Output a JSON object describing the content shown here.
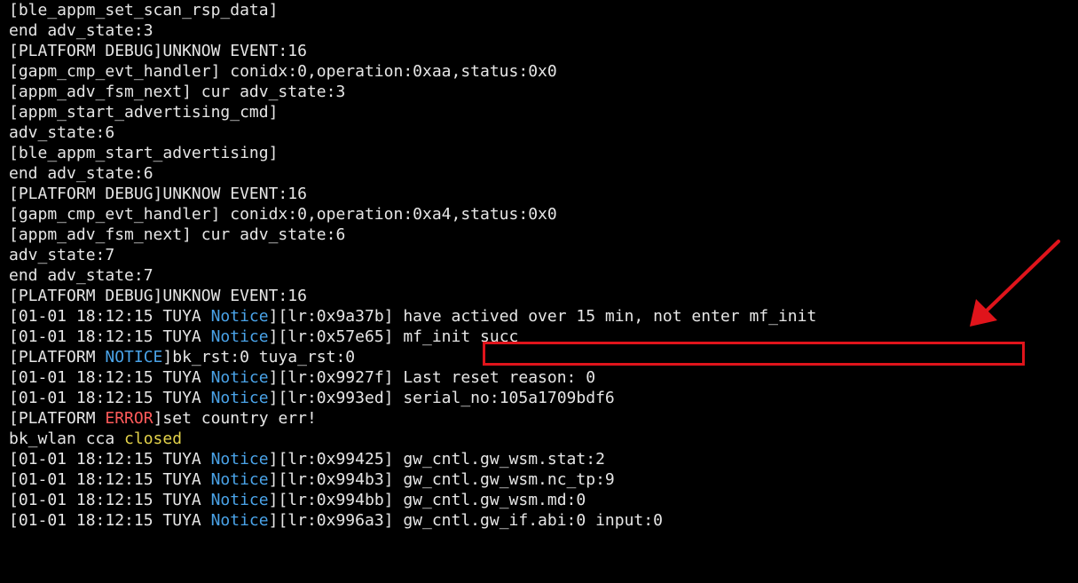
{
  "colors": {
    "background": "#000000",
    "text": "#e6e6e6",
    "notice_blue": "#4aa3e8",
    "error_red": "#ff5a5a",
    "closed_yellow": "#e3d24a",
    "annotation_red": "#e0141b"
  },
  "annotation": {
    "box_label": "highlighted log message",
    "arrow_icon": "red-arrow-icon"
  },
  "terminal": {
    "lines": [
      [
        {
          "t": "[ble_appm_set_scan_rsp_data]",
          "c": "default"
        }
      ],
      [
        {
          "t": "end adv_state:3",
          "c": "default"
        }
      ],
      [
        {
          "t": "[PLATFORM DEBUG]UNKNOW EVENT:16",
          "c": "default"
        }
      ],
      [
        {
          "t": "[gapm_cmp_evt_handler] conidx:0,operation:0xaa,status:0x0",
          "c": "default"
        }
      ],
      [
        {
          "t": "[appm_adv_fsm_next] cur adv_state:3",
          "c": "default"
        }
      ],
      [
        {
          "t": "[appm_start_advertising_cmd]",
          "c": "default"
        }
      ],
      [
        {
          "t": "adv_state:6",
          "c": "default"
        }
      ],
      [
        {
          "t": "[ble_appm_start_advertising]",
          "c": "default"
        }
      ],
      [
        {
          "t": "end adv_state:6",
          "c": "default"
        }
      ],
      [
        {
          "t": "[PLATFORM DEBUG]UNKNOW EVENT:16",
          "c": "default"
        }
      ],
      [
        {
          "t": "[gapm_cmp_evt_handler] conidx:0,operation:0xa4,status:0x0",
          "c": "default"
        }
      ],
      [
        {
          "t": "[appm_adv_fsm_next] cur adv_state:6",
          "c": "default"
        }
      ],
      [
        {
          "t": "adv_state:7",
          "c": "default"
        }
      ],
      [
        {
          "t": "end adv_state:7",
          "c": "default"
        }
      ],
      [
        {
          "t": "[PLATFORM DEBUG]UNKNOW EVENT:16",
          "c": "default"
        }
      ],
      [
        {
          "t": "[01-01 18:12:15 TUYA ",
          "c": "default"
        },
        {
          "t": "Notice",
          "c": "blue"
        },
        {
          "t": "][lr:0x9a37b] have actived over 15 min, not enter mf_init",
          "c": "default"
        }
      ],
      [
        {
          "t": "[01-01 18:12:15 TUYA ",
          "c": "default"
        },
        {
          "t": "Notice",
          "c": "blue"
        },
        {
          "t": "][lr:0x57e65] mf_init succ",
          "c": "default"
        }
      ],
      [
        {
          "t": "[PLATFORM ",
          "c": "default"
        },
        {
          "t": "NOTICE",
          "c": "blue"
        },
        {
          "t": "]bk_rst:0 tuya_rst:0",
          "c": "default"
        }
      ],
      [
        {
          "t": "[01-01 18:12:15 TUYA ",
          "c": "default"
        },
        {
          "t": "Notice",
          "c": "blue"
        },
        {
          "t": "][lr:0x9927f] Last reset reason: 0",
          "c": "default"
        }
      ],
      [
        {
          "t": "[01-01 18:12:15 TUYA ",
          "c": "default"
        },
        {
          "t": "Notice",
          "c": "blue"
        },
        {
          "t": "][lr:0x993ed] serial_no:105a1709bdf6",
          "c": "default"
        }
      ],
      [
        {
          "t": "[PLATFORM ",
          "c": "default"
        },
        {
          "t": "ERROR",
          "c": "red"
        },
        {
          "t": "]set country err!",
          "c": "default"
        }
      ],
      [
        {
          "t": "bk_wlan cca ",
          "c": "default"
        },
        {
          "t": "closed",
          "c": "yellow"
        }
      ],
      [
        {
          "t": "[01-01 18:12:15 TUYA ",
          "c": "default"
        },
        {
          "t": "Notice",
          "c": "blue"
        },
        {
          "t": "][lr:0x99425] gw_cntl.gw_wsm.stat:2",
          "c": "default"
        }
      ],
      [
        {
          "t": "[01-01 18:12:15 TUYA ",
          "c": "default"
        },
        {
          "t": "Notice",
          "c": "blue"
        },
        {
          "t": "][lr:0x994b3] gw_cntl.gw_wsm.nc_tp:9",
          "c": "default"
        }
      ],
      [
        {
          "t": "[01-01 18:12:15 TUYA ",
          "c": "default"
        },
        {
          "t": "Notice",
          "c": "blue"
        },
        {
          "t": "][lr:0x994bb] gw_cntl.gw_wsm.md:0",
          "c": "default"
        }
      ],
      [
        {
          "t": "[01-01 18:12:15 TUYA ",
          "c": "default"
        },
        {
          "t": "Notice",
          "c": "blue"
        },
        {
          "t": "][lr:0x996a3] gw_cntl.gw_if.abi:0 input:0",
          "c": "default"
        }
      ]
    ]
  }
}
